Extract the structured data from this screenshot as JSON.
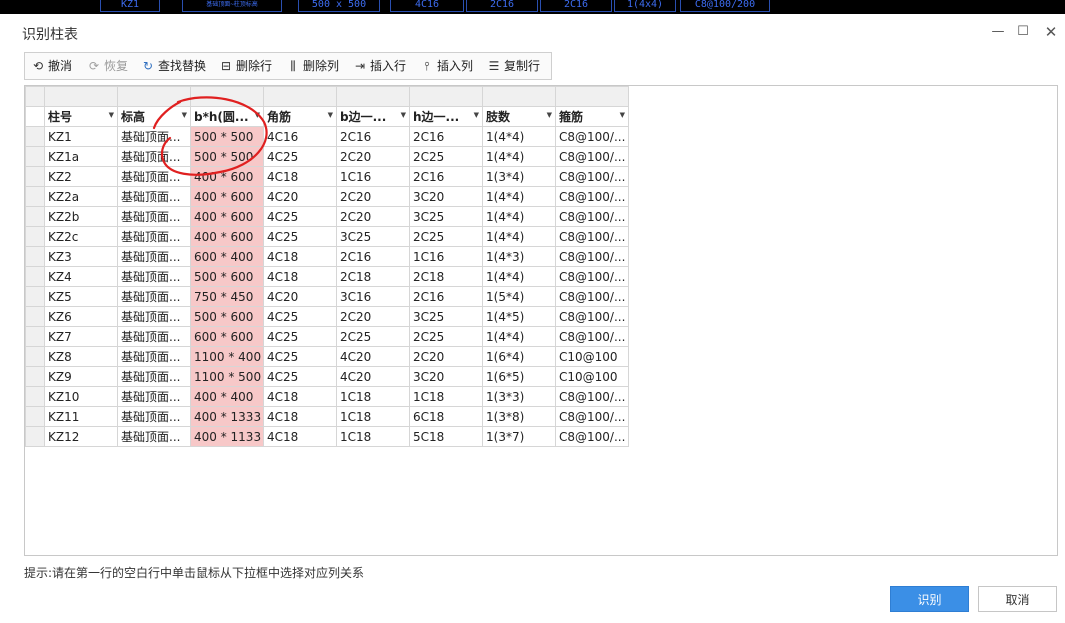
{
  "background_strip": [
    "KZ1",
    "基础顶面~柱顶标高",
    "500 x 500",
    "4C16",
    "2C16",
    "2C16",
    "1(4x4)",
    "C8@100/200"
  ],
  "dialog": {
    "title": "识别柱表",
    "controls": {
      "minimize": "—",
      "maximize": "☐",
      "close": "✕"
    }
  },
  "toolbar": {
    "undo": "撤消",
    "redo": "恢复",
    "find_replace": "查找替换",
    "delete_row": "删除行",
    "delete_col": "删除列",
    "insert_row": "插入行",
    "insert_col": "插入列",
    "copy_row": "复制行"
  },
  "grid": {
    "headers": [
      "柱号",
      "标高",
      "b*h(圆...",
      "角筋",
      "b边一...",
      "h边一...",
      "肢数",
      "箍筋"
    ],
    "rows": [
      [
        "KZ1",
        "基础顶面...",
        "500 * 500",
        "4C16",
        "2C16",
        "2C16",
        "1(4*4)",
        "C8@100/..."
      ],
      [
        "KZ1a",
        "基础顶面...",
        "500 * 500",
        "4C25",
        "2C20",
        "2C25",
        "1(4*4)",
        "C8@100/..."
      ],
      [
        "KZ2",
        "基础顶面...",
        "400 * 600",
        "4C18",
        "1C16",
        "2C16",
        "1(3*4)",
        "C8@100/..."
      ],
      [
        "KZ2a",
        "基础顶面...",
        "400 * 600",
        "4C20",
        "2C20",
        "3C20",
        "1(4*4)",
        "C8@100/..."
      ],
      [
        "KZ2b",
        "基础顶面...",
        "400 * 600",
        "4C25",
        "2C20",
        "3C25",
        "1(4*4)",
        "C8@100/..."
      ],
      [
        "KZ2c",
        "基础顶面...",
        "400 * 600",
        "4C25",
        "3C25",
        "2C25",
        "1(4*4)",
        "C8@100/..."
      ],
      [
        "KZ3",
        "基础顶面...",
        "600 * 400",
        "4C18",
        "2C16",
        "1C16",
        "1(4*3)",
        "C8@100/..."
      ],
      [
        "KZ4",
        "基础顶面...",
        "500 * 600",
        "4C18",
        "2C18",
        "2C18",
        "1(4*4)",
        "C8@100/..."
      ],
      [
        "KZ5",
        "基础顶面...",
        "750 * 450",
        "4C20",
        "3C16",
        "2C16",
        "1(5*4)",
        "C8@100/..."
      ],
      [
        "KZ6",
        "基础顶面...",
        "500 * 600",
        "4C25",
        "2C20",
        "3C25",
        "1(4*5)",
        "C8@100/..."
      ],
      [
        "KZ7",
        "基础顶面...",
        "600 * 600",
        "4C25",
        "2C25",
        "2C25",
        "1(4*4)",
        "C8@100/..."
      ],
      [
        "KZ8",
        "基础顶面...",
        "1100 * 400",
        "4C25",
        "4C20",
        "2C20",
        "1(6*4)",
        "C10@100"
      ],
      [
        "KZ9",
        "基础顶面...",
        "1100 * 500",
        "4C25",
        "4C20",
        "3C20",
        "1(6*5)",
        "C10@100"
      ],
      [
        "KZ10",
        "基础顶面...",
        "400 * 400",
        "4C18",
        "1C18",
        "1C18",
        "1(3*3)",
        "C8@100/..."
      ],
      [
        "KZ11",
        "基础顶面...",
        "400 * 1333",
        "4C18",
        "1C18",
        "6C18",
        "1(3*8)",
        "C8@100/..."
      ],
      [
        "KZ12",
        "基础顶面...",
        "400 * 1133",
        "4C18",
        "1C18",
        "5C18",
        "1(3*7)",
        "C8@100/..."
      ]
    ]
  },
  "hint": "提示:请在第一行的空白行中单击鼠标从下拉框中选择对应列关系",
  "buttons": {
    "recognize": "识别",
    "cancel": "取消"
  },
  "colors": {
    "highlight_column": "#f7c8c8",
    "primary_button": "#3b8fe6",
    "annotation_circle": "#e02020"
  }
}
